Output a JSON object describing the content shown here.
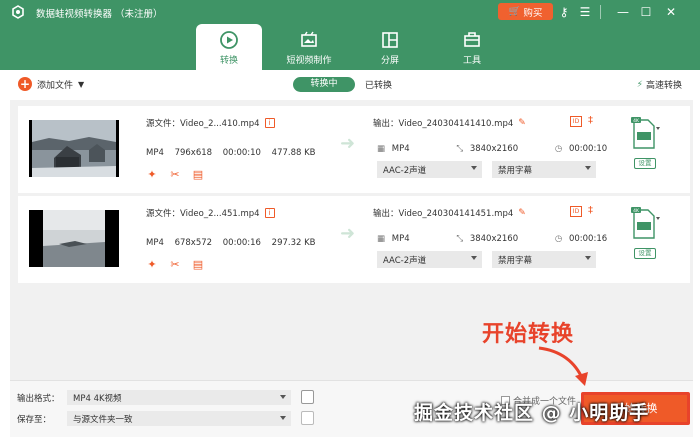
{
  "app": {
    "title": "数据蛙视频转换器 （未注册）",
    "buy_label": "购买",
    "accent": "#3f9466",
    "brand_orange": "#ef5a28"
  },
  "titlebar_icons": [
    "key-icon",
    "menu-icon",
    "minimize-icon",
    "maximize-icon",
    "close-icon"
  ],
  "tabs": [
    {
      "label": "转换",
      "icon": "convert-icon",
      "active": true
    },
    {
      "label": "短视频制作",
      "icon": "short-video-icon",
      "active": false
    },
    {
      "label": "分屏",
      "icon": "split-screen-icon",
      "active": false
    },
    {
      "label": "工具",
      "icon": "toolbox-icon",
      "active": false
    }
  ],
  "toolbar": {
    "add_file": "添加文件",
    "converting": "转换中",
    "converted": "已转换",
    "speed": "高速转换"
  },
  "files": [
    {
      "source": "源文件：Video_2...410.mp4",
      "format": "MP4",
      "resolution": "796x618",
      "duration": "00:00:10",
      "size": "477.88 KB",
      "output": "输出：Video_240304141410.mp4",
      "out_format": "MP4",
      "out_resolution": "3840x2160",
      "out_duration": "00:00:10",
      "audio": "AAC-2声道",
      "subtitle": "禁用字幕",
      "format_badge": "4K",
      "setting": "设置"
    },
    {
      "source": "源文件：Video_2...451.mp4",
      "format": "MP4",
      "resolution": "678x572",
      "duration": "00:00:16",
      "size": "297.32 KB",
      "output": "输出：Video_240304141451.mp4",
      "out_format": "MP4",
      "out_resolution": "3840x2160",
      "out_duration": "00:00:16",
      "audio": "AAC-2声道",
      "subtitle": "禁用字幕",
      "format_badge": "4K",
      "setting": "设置"
    }
  ],
  "bottom": {
    "output_format_label": "输出格式：",
    "output_format_value": "MP4 4K视频",
    "save_label": "保存至：",
    "save_value": "与源文件夹一致",
    "merge_label": "合并成一个文件",
    "start_label": "开始转换"
  },
  "annotation": "开始转换",
  "watermark": "掘金技术社区 @ 小明助手"
}
